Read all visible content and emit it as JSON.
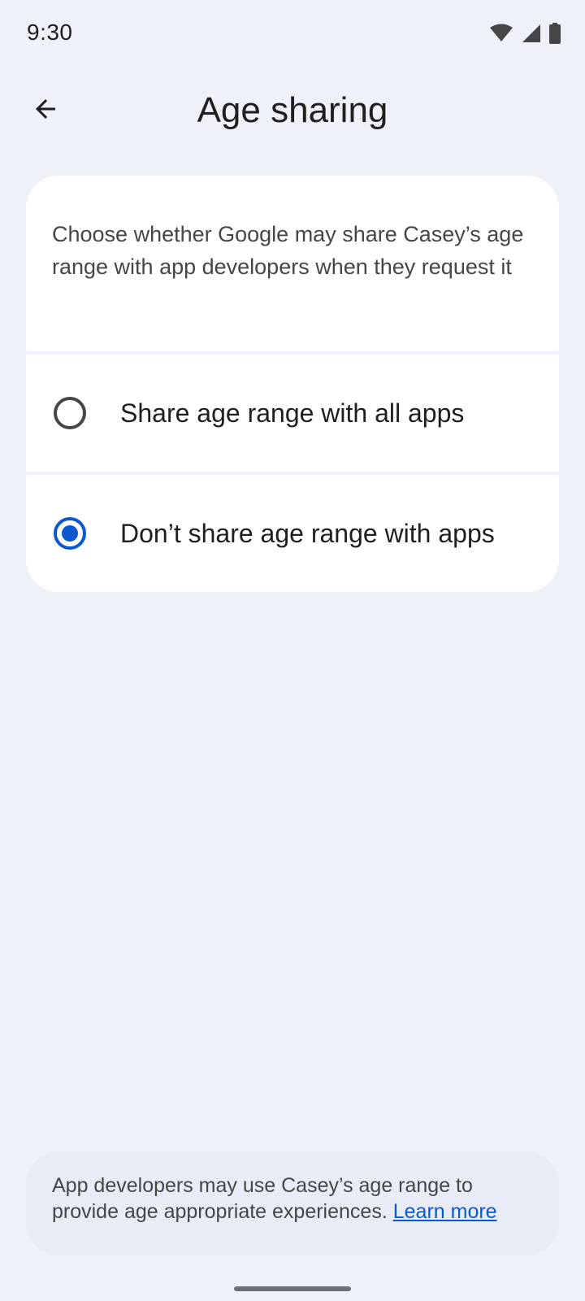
{
  "status_bar": {
    "time": "9:30",
    "icons": [
      "wifi-icon",
      "cellular-signal-icon",
      "battery-icon"
    ]
  },
  "app_bar": {
    "back_icon": "arrow-back-icon",
    "title": "Age sharing"
  },
  "description": "Choose whether Google may share Casey’s age range with app developers when they request it",
  "options": [
    {
      "label": "Share age range with all apps",
      "selected": false
    },
    {
      "label": "Don’t share age range with apps",
      "selected": true
    }
  ],
  "footer": {
    "text": "App developers may use Casey’s age range to provide age appropriate experiences.",
    "link_label": "Learn more"
  },
  "colors": {
    "background": "#eef2f8",
    "surface": "#ffffff",
    "accent": "#0b57d0",
    "footer_surface": "#e8ecf6",
    "text_primary": "#1f1f1f",
    "text_secondary": "#444746"
  }
}
